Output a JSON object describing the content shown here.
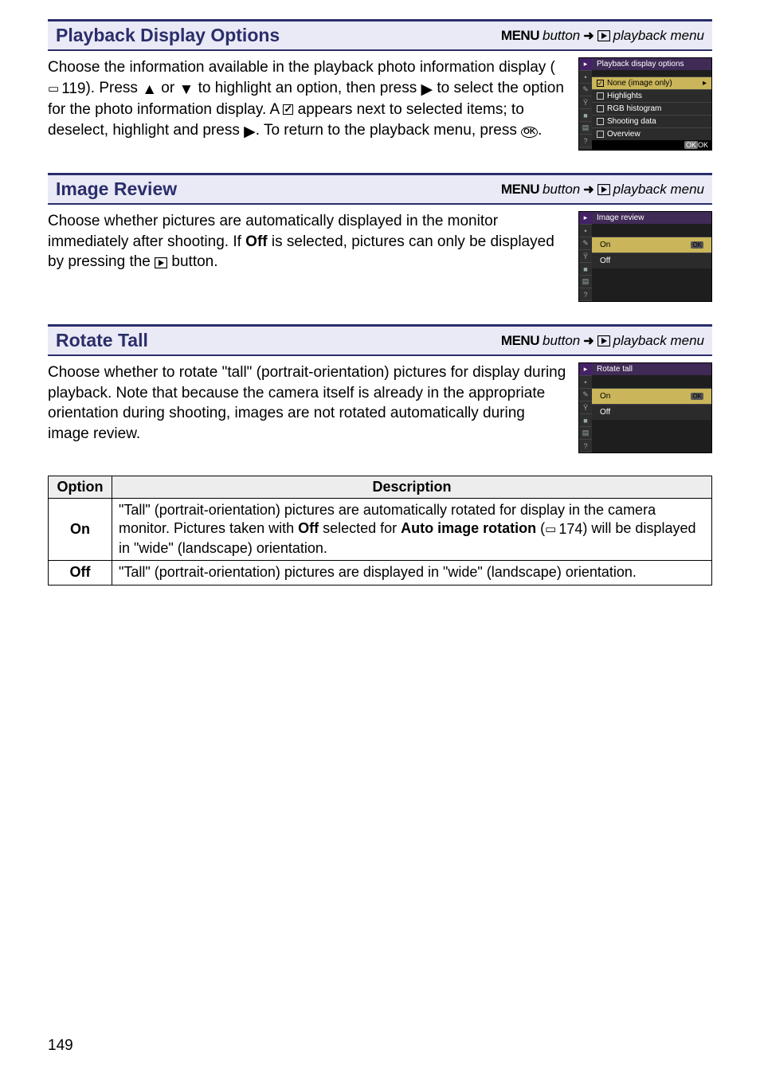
{
  "sections": {
    "playback_display": {
      "title": "Playback Display Options",
      "menu_label_prefix": "MENU",
      "menu_label_mid": "button",
      "menu_label_suffix": "playback menu",
      "body_prefix": "Choose the information available in the playback photo information display (",
      "body_ref": "119",
      "body_mid1": ").  Press ",
      "body_mid2": " or ",
      "body_mid3": " to highlight an option, then press ",
      "body_mid4": " to select the option for the photo information display.  A ",
      "body_mid5": " appears next to selected items; to deselect, highlight and press ",
      "body_mid6": ".  To return to the playback menu, press ",
      "body_end": ".",
      "panel": {
        "title": "Playback display options",
        "items": [
          "None (image only)",
          "Highlights",
          "RGB histogram",
          "Shooting data",
          "Overview"
        ],
        "selected_index": 0,
        "checked": [
          true,
          false,
          false,
          false,
          false
        ],
        "footer": "OK",
        "footer_suffix": "OK"
      }
    },
    "image_review": {
      "title": "Image Review",
      "menu_label_prefix": "MENU",
      "menu_label_mid": "button",
      "menu_label_suffix": "playback menu",
      "body_prefix": "Choose whether pictures are automatically displayed in the monitor immediately after shooting.  If ",
      "body_bold": "Off",
      "body_mid": " is selected, pictures can only be displayed by pressing the ",
      "body_end": " button.",
      "panel": {
        "title": "Image review",
        "items": [
          "On",
          "Off"
        ],
        "selected_index": 0
      }
    },
    "rotate_tall": {
      "title": "Rotate Tall",
      "menu_label_prefix": "MENU",
      "menu_label_mid": "button",
      "menu_label_suffix": "playback menu",
      "body": "Choose whether to rotate \"tall\" (portrait-orientation) pictures for display during playback.  Note that because the camera itself is already in the appropriate orientation during shooting, images are not rotated automatically during image review.",
      "panel": {
        "title": "Rotate tall",
        "items": [
          "On",
          "Off"
        ],
        "selected_index": 0
      }
    }
  },
  "table": {
    "headers": [
      "Option",
      "Description"
    ],
    "rows": [
      {
        "option": "On",
        "desc_prefix": "\"Tall\" (portrait-orientation) pictures are automatically rotated for display in the camera monitor.  Pictures taken with ",
        "desc_bold1": "Off",
        "desc_mid": " selected for ",
        "desc_bold2": "Auto image rotation",
        "desc_ref": "174",
        "desc_suffix": ") will be displayed in \"wide\" (landscape) orientation."
      },
      {
        "option": "Off",
        "desc": "\"Tall\" (portrait-orientation) pictures are displayed in \"wide\" (landscape) orientation."
      }
    ]
  },
  "page_number": "149"
}
